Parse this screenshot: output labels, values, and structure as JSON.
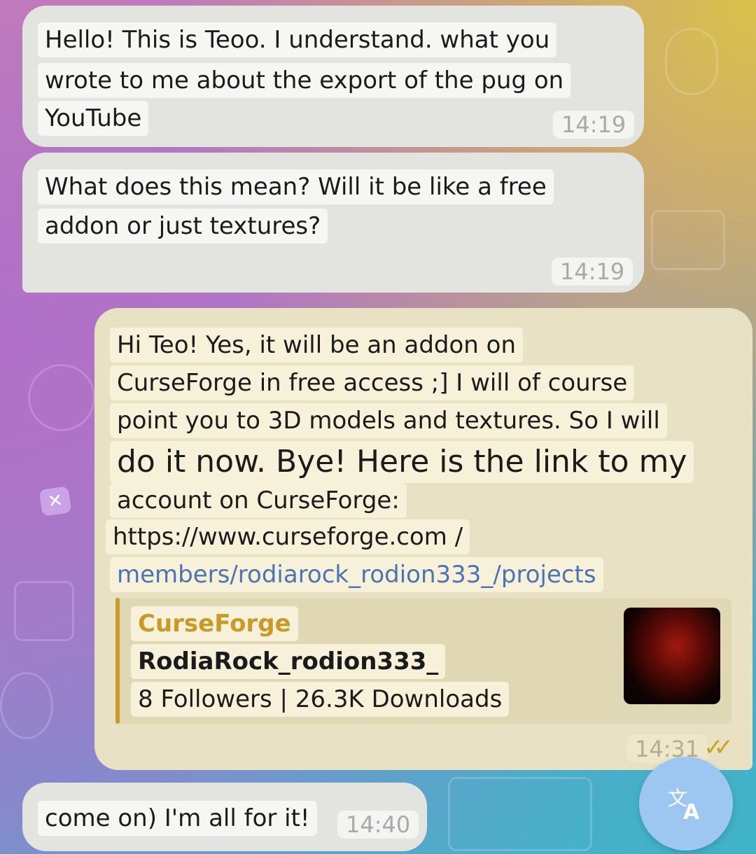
{
  "messages": [
    {
      "id": "msg1",
      "direction": "incoming",
      "lines": [
        "Hello! This is Teoo. I understand. what you",
        "wrote to me about the export of the pug on",
        "YouTube"
      ],
      "time": "14:19"
    },
    {
      "id": "msg2",
      "direction": "incoming",
      "lines": [
        "What does this mean? Will it be like a free",
        "addon or just textures?"
      ],
      "time": "14:19"
    },
    {
      "id": "msg3",
      "direction": "outgoing",
      "lines": [
        "Hi Teo! Yes, it will be an addon on",
        "CurseForge in free access ;] I will of course",
        "point you to 3D models and textures. So I will",
        "do it now. Bye! Here is the link to my",
        "account on CurseForge:",
        "https://www.curseforge.com /",
        "members/rodiarock_rodion333_/projects"
      ],
      "link_preview": {
        "site": "CurseForge",
        "title": "RodiaRock_rodion333_",
        "description": "8 Followers | 26.3K Downloads"
      },
      "time": "14:31",
      "status": "read"
    },
    {
      "id": "msg4",
      "direction": "incoming",
      "lines": [
        "come on) I'm all for it!"
      ],
      "time": "14:40"
    }
  ],
  "translate_button": {
    "icon": "translate-icon"
  },
  "colors": {
    "incoming_bubble": "#e3e3e0",
    "outgoing_bubble": "#e8e1c4",
    "link": "#4a74b4",
    "preview_accent": "#c79a2a",
    "read_ticks": "#c9a227"
  }
}
